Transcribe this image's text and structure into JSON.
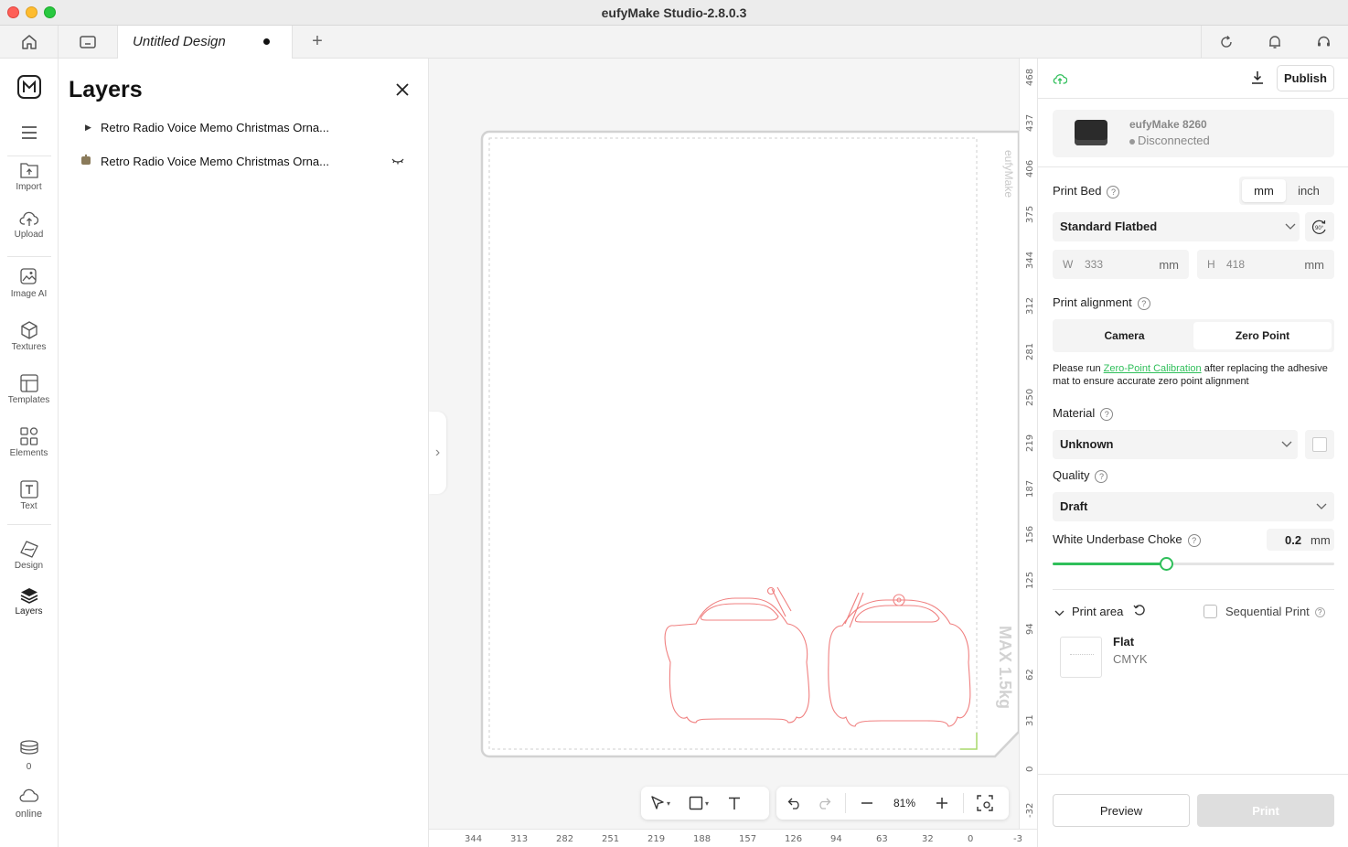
{
  "window": {
    "title": "eufyMake Studio-2.8.0.3"
  },
  "tabs": {
    "active_title": "Untitled Design"
  },
  "rail": {
    "items": [
      {
        "label": "Import"
      },
      {
        "label": "Upload"
      },
      {
        "label": "Image AI"
      },
      {
        "label": "Textures"
      },
      {
        "label": "Templates"
      },
      {
        "label": "Elements"
      },
      {
        "label": "Text"
      },
      {
        "label": "Design"
      },
      {
        "label": "Layers"
      }
    ],
    "count": "0",
    "status": "online"
  },
  "layers": {
    "title": "Layers",
    "items": [
      {
        "name": "Retro Radio Voice Memo Christmas Orna..."
      },
      {
        "name": "Retro Radio Voice Memo Christmas Orna..."
      }
    ]
  },
  "canvas": {
    "bed_brand": "eufyMake",
    "max_weight": "MAX 1.5kg",
    "vruler": [
      "468",
      "437",
      "406",
      "375",
      "344",
      "312",
      "281",
      "250",
      "219",
      "187",
      "156",
      "125",
      "94",
      "62",
      "31",
      "0",
      "-32"
    ],
    "hruler": [
      "344",
      "313",
      "282",
      "251",
      "219",
      "188",
      "157",
      "126",
      "94",
      "63",
      "32",
      "0",
      "-3"
    ],
    "zoom": "81%"
  },
  "panel": {
    "publish_label": "Publish",
    "printer": {
      "name": "eufyMake 8260",
      "status": "Disconnected"
    },
    "print_bed": {
      "label": "Print Bed",
      "units": [
        "mm",
        "inch"
      ],
      "selected_unit": "mm",
      "bed_type": "Standard Flatbed",
      "rotate_label": "90°",
      "w_label": "W",
      "w_value": "333",
      "w_unit": "mm",
      "h_label": "H",
      "h_value": "418",
      "h_unit": "mm"
    },
    "alignment": {
      "label": "Print alignment",
      "options": [
        "Camera",
        "Zero Point"
      ],
      "selected": "Zero Point",
      "note_prefix": "Please run ",
      "note_link": "Zero-Point Calibration",
      "note_suffix": " after replacing the adhesive mat to ensure accurate zero point alignment"
    },
    "material": {
      "label": "Material",
      "value": "Unknown"
    },
    "quality": {
      "label": "Quality",
      "value": "Draft"
    },
    "choke": {
      "label": "White Underbase Choke",
      "value": "0.2",
      "unit": "mm",
      "fraction": 0.403
    },
    "print_area": {
      "label": "Print area",
      "sequential_label": "Sequential Print",
      "mode": "Flat",
      "color_mode": "CMYK"
    },
    "preview_label": "Preview",
    "print_label": "Print"
  },
  "colors": {
    "accent": "#2fbf5a",
    "cut_line": "#f08080"
  }
}
